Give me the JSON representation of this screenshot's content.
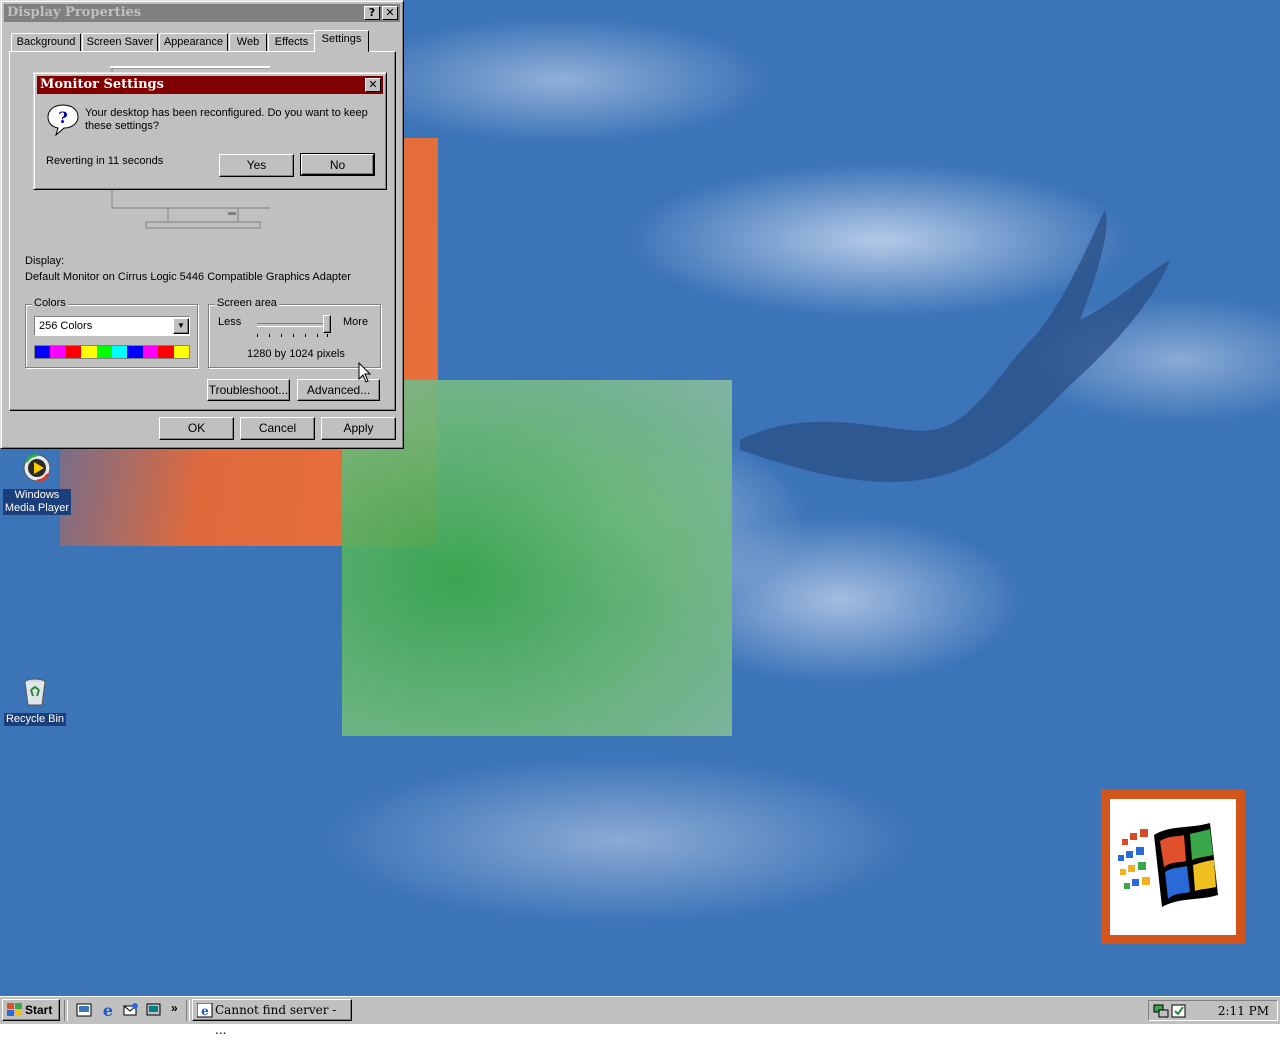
{
  "colors": {
    "desktop": "#3c74b8",
    "window_face": "#c0c0c0",
    "title_active": "#800000",
    "title_inactive": "#808080",
    "logo_tile": "#d2561c"
  },
  "desktop": {
    "icons": [
      {
        "label_line1": "Windows",
        "label_line2": "Media Player",
        "icon": "media-player-icon"
      },
      {
        "label": "Recycle Bin",
        "icon": "recycle-bin-icon"
      }
    ]
  },
  "display_properties": {
    "title": "Display Properties",
    "help_glyph": "?",
    "close_glyph": "✕",
    "tabs": [
      {
        "label": "Background"
      },
      {
        "label": "Screen Saver"
      },
      {
        "label": "Appearance"
      },
      {
        "label": "Web"
      },
      {
        "label": "Effects"
      },
      {
        "label": "Settings",
        "active": true
      }
    ],
    "display_label": "Display:",
    "display_value": "Default Monitor on Cirrus Logic 5446 Compatible Graphics Adapter",
    "colors_group": {
      "title": "Colors",
      "selected": "256 Colors",
      "palette": [
        "#0000ff",
        "#ff00ff",
        "#ff0000",
        "#ffff00",
        "#00ff00",
        "#00ffff",
        "#0000ff",
        "#ff00ff",
        "#ff0000",
        "#ffff00"
      ]
    },
    "screen_area_group": {
      "title": "Screen area",
      "less_label": "Less",
      "more_label": "More",
      "slider_level": 1.0,
      "value_text": "1280 by 1024 pixels"
    },
    "troubleshoot_label": "Troubleshoot...",
    "advanced_label": "Advanced...",
    "ok_label": "OK",
    "cancel_label": "Cancel",
    "apply_label": "Apply"
  },
  "monitor_settings": {
    "title": "Monitor Settings",
    "close_glyph": "✕",
    "message_line1": "Your desktop has been reconfigured.  Do you want to keep",
    "message_line2": "these settings?",
    "countdown": "Reverting in 11 seconds",
    "yes_label": "Yes",
    "no_label": "No"
  },
  "taskbar": {
    "start_label": "Start",
    "quicklaunch": [
      "ie-channels-icon",
      "internet-explorer-icon",
      "outlook-express-icon",
      "show-desktop-icon"
    ],
    "chevron": "»",
    "task_button_label": "Cannot find server - ...",
    "clock": "2:11 PM"
  }
}
